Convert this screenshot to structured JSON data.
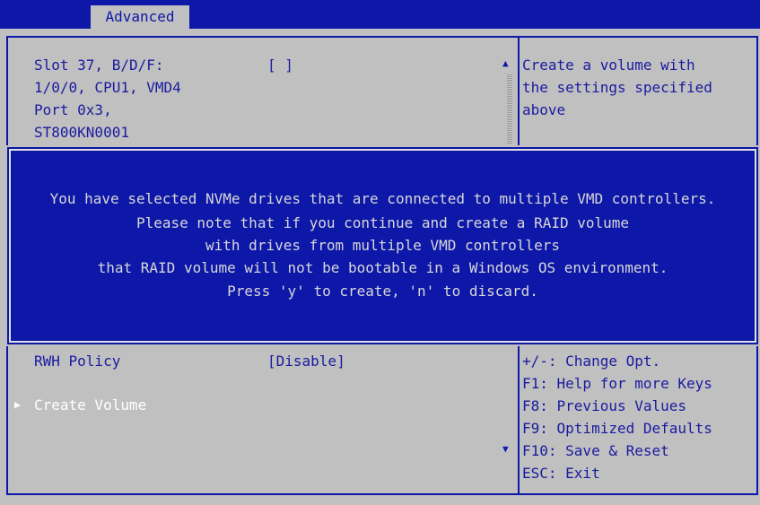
{
  "tabs": {
    "active": "Advanced"
  },
  "top_item": {
    "lines": [
      "Slot 37, B/D/F:",
      "1/0/0, CPU1, VMD4",
      "Port 0x3,",
      "ST800KN0001"
    ],
    "value": "[ ]"
  },
  "help_top": [
    "Create a volume with",
    "the settings specified",
    "above"
  ],
  "dialog": {
    "lines": [
      "You have selected NVMe drives that are connected to multiple VMD controllers.",
      "Please note that if you continue and create a RAID volume",
      "with drives from multiple VMD controllers",
      "that RAID volume will not be bootable in a Windows OS environment.",
      "Press 'y' to create, 'n' to discard."
    ]
  },
  "rwh": {
    "label": "RWH Policy",
    "value": "[Disable]"
  },
  "create_volume": {
    "label": "Create Volume"
  },
  "keys_help": [
    "+/-: Change Opt.",
    "F1: Help for more Keys",
    "F8: Previous Values",
    "F9: Optimized Defaults",
    "F10: Save & Reset",
    "ESC: Exit"
  ],
  "icons": {
    "scroll_up": "triangle-up-icon",
    "scroll_down": "triangle-down-icon",
    "submenu": "triangle-right-icon"
  },
  "colors": {
    "bios_blue": "#0d17a8",
    "bios_gray": "#c0c0c0"
  }
}
